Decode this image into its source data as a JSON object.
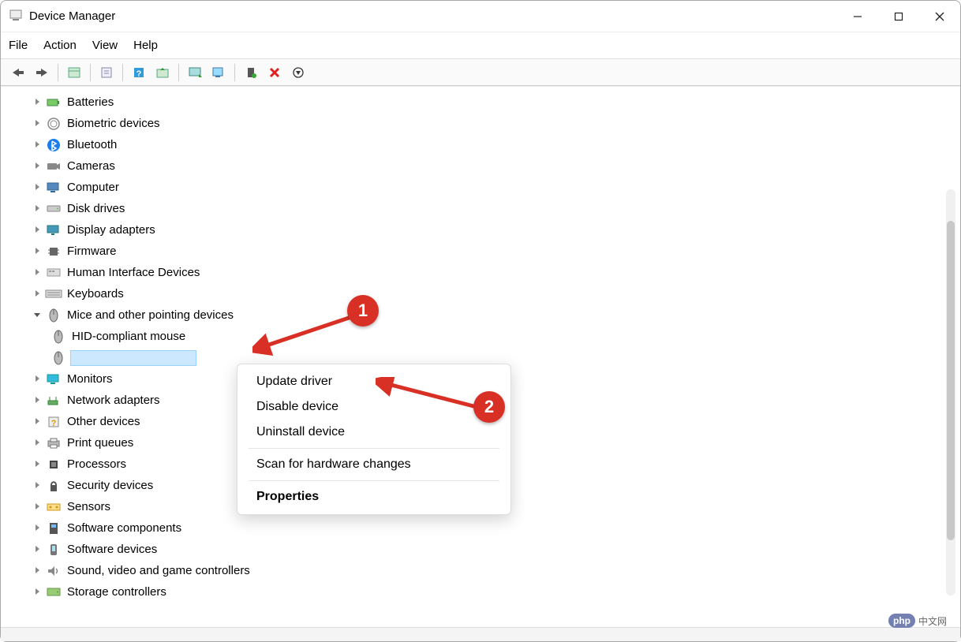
{
  "window": {
    "title": "Device Manager"
  },
  "menubar": {
    "file": "File",
    "action": "Action",
    "view": "View",
    "help": "Help"
  },
  "toolbar_icons": [
    "back",
    "forward",
    "show-hidden",
    "properties",
    "help",
    "update",
    "scan",
    "enable",
    "disable",
    "uninstall"
  ],
  "tree": [
    {
      "label": "Batteries",
      "icon": "battery"
    },
    {
      "label": "Biometric devices",
      "icon": "fingerprint"
    },
    {
      "label": "Bluetooth",
      "icon": "bluetooth"
    },
    {
      "label": "Cameras",
      "icon": "camera"
    },
    {
      "label": "Computer",
      "icon": "computer"
    },
    {
      "label": "Disk drives",
      "icon": "disk"
    },
    {
      "label": "Display adapters",
      "icon": "display"
    },
    {
      "label": "Firmware",
      "icon": "chip"
    },
    {
      "label": "Human Interface Devices",
      "icon": "hid"
    },
    {
      "label": "Keyboards",
      "icon": "keyboard"
    },
    {
      "label": "Mice and other pointing devices",
      "icon": "mouse",
      "expanded": true,
      "children": [
        {
          "label": "HID-compliant mouse",
          "icon": "mouse"
        },
        {
          "label": "",
          "icon": "mouse",
          "selected": true
        }
      ]
    },
    {
      "label": "Monitors",
      "icon": "monitor"
    },
    {
      "label": "Network adapters",
      "icon": "network"
    },
    {
      "label": "Other devices",
      "icon": "other"
    },
    {
      "label": "Print queues",
      "icon": "printer"
    },
    {
      "label": "Processors",
      "icon": "cpu"
    },
    {
      "label": "Security devices",
      "icon": "security"
    },
    {
      "label": "Sensors",
      "icon": "sensor"
    },
    {
      "label": "Software components",
      "icon": "software"
    },
    {
      "label": "Software devices",
      "icon": "softdev"
    },
    {
      "label": "Sound, video and game controllers",
      "icon": "sound"
    },
    {
      "label": "Storage controllers",
      "icon": "storage"
    }
  ],
  "context_menu": {
    "update": "Update driver",
    "disable": "Disable device",
    "uninstall": "Uninstall device",
    "scan": "Scan for hardware changes",
    "properties": "Properties"
  },
  "annotations": {
    "badge1": "1",
    "badge2": "2"
  },
  "watermark": {
    "brand": "php",
    "text": "中文网"
  }
}
